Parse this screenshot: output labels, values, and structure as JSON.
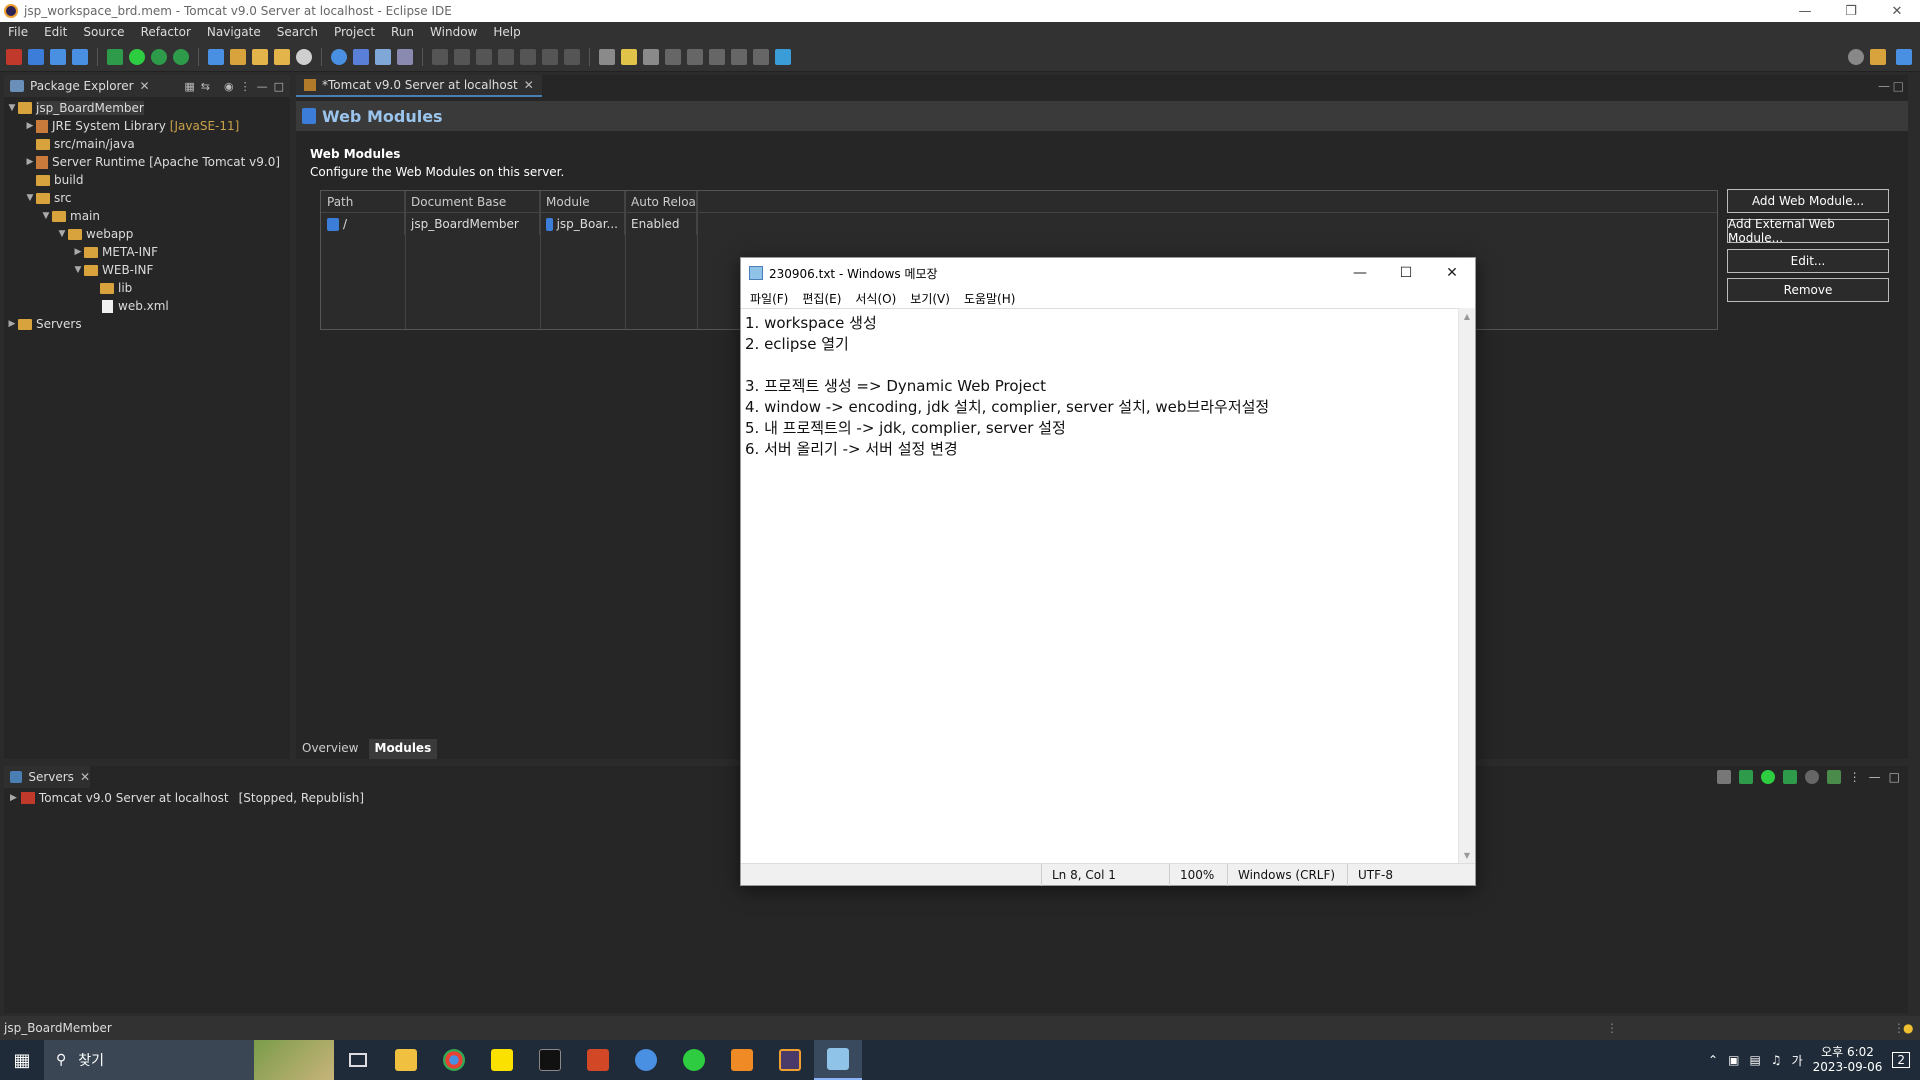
{
  "window": {
    "title": "jsp_workspace_brd.mem - Tomcat v9.0 Server at localhost - Eclipse IDE"
  },
  "menubar": [
    "File",
    "Edit",
    "Source",
    "Refactor",
    "Navigate",
    "Search",
    "Project",
    "Run",
    "Window",
    "Help"
  ],
  "package_explorer": {
    "tab_label": "Package Explorer",
    "tree": [
      {
        "label": "jsp_BoardMember",
        "extra": "",
        "type": "project"
      },
      {
        "label": "JRE System Library",
        "extra": "[JavaSE-11]",
        "type": "library"
      },
      {
        "label": "src/main/java",
        "extra": "",
        "type": "folder"
      },
      {
        "label": "Server Runtime [Apache Tomcat v9.0]",
        "extra": "",
        "type": "library"
      },
      {
        "label": "build",
        "extra": "",
        "type": "folder"
      },
      {
        "label": "src",
        "extra": "",
        "type": "folder"
      },
      {
        "label": "main",
        "extra": "",
        "type": "folder"
      },
      {
        "label": "webapp",
        "extra": "",
        "type": "folder"
      },
      {
        "label": "META-INF",
        "extra": "",
        "type": "folder"
      },
      {
        "label": "WEB-INF",
        "extra": "",
        "type": "folder"
      },
      {
        "label": "lib",
        "extra": "",
        "type": "folder"
      },
      {
        "label": "web.xml",
        "extra": "",
        "type": "file"
      },
      {
        "label": "Servers",
        "extra": "",
        "type": "folder"
      }
    ]
  },
  "editor": {
    "tab_label": "*Tomcat v9.0 Server at localhost",
    "header": "Web Modules",
    "section_title": "Web Modules",
    "section_desc": "Configure the Web Modules on this server.",
    "table": {
      "headers": [
        "Path",
        "Document Base",
        "Module",
        "Auto Reloa"
      ],
      "rows": [
        {
          "path": "/",
          "doc_base": "jsp_BoardMember",
          "module": "jsp_Boar...",
          "auto_reload": "Enabled"
        }
      ]
    },
    "buttons": [
      "Add Web Module...",
      "Add External Web Module...",
      "Edit...",
      "Remove"
    ],
    "bottom_tabs": [
      "Overview",
      "Modules"
    ]
  },
  "servers_view": {
    "tab_label": "Servers",
    "server_name": "Tomcat v9.0 Server at localhost",
    "server_state": "[Stopped, Republish]"
  },
  "statusbar": {
    "selection": "jsp_BoardMember"
  },
  "notepad": {
    "title": "230906.txt - Windows 메모장",
    "menu": [
      "파일(F)",
      "편집(E)",
      "서식(O)",
      "보기(V)",
      "도움말(H)"
    ],
    "lines": [
      "1. workspace 생성",
      "2. eclipse 열기",
      "",
      "3. 프로젝트 생성 => Dynamic Web Project",
      "4. window -> encoding, jdk 설치, complier, server 설치, web브라우저설정",
      "5. 내 프로젝트의 -> jdk, complier, server 설정",
      "6. 서버 올리기 -> 서버 설정 변경"
    ],
    "status": {
      "position": "Ln 8, Col 1",
      "zoom": "100%",
      "line_ending": "Windows (CRLF)",
      "encoding": "UTF-8"
    }
  },
  "taskbar": {
    "search_placeholder": "찾기",
    "ime": "가",
    "time": "오후 6:02",
    "date": "2023-09-06",
    "notification_count": "2"
  },
  "colors": {
    "accent": "#4a7fb5",
    "header_text": "#9ac4ec",
    "folder": "#d8a23c"
  }
}
